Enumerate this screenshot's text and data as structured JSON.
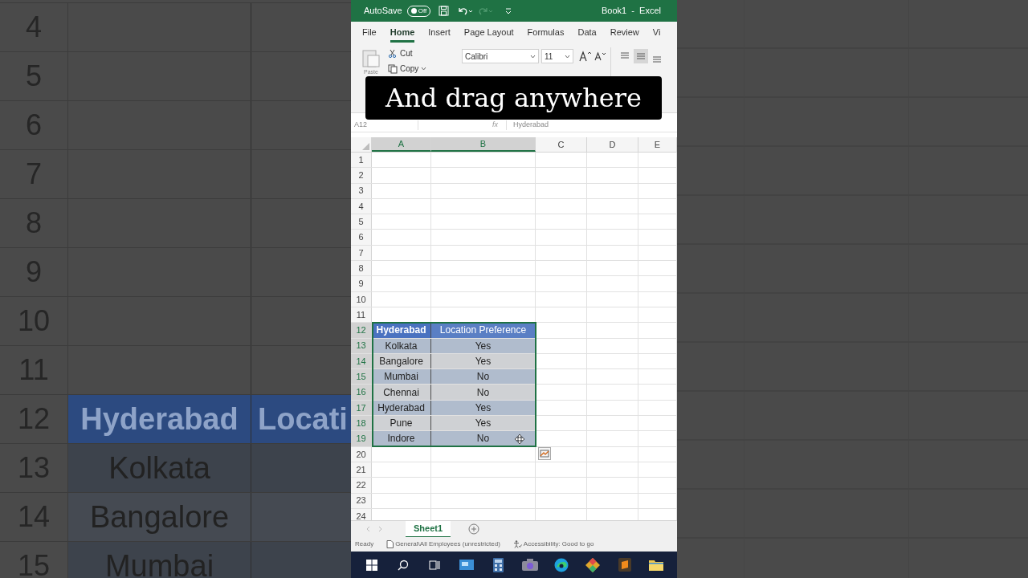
{
  "backdrop": {
    "rows": [
      {
        "number": "4"
      },
      {
        "number": "5"
      },
      {
        "number": "6"
      },
      {
        "number": "7"
      },
      {
        "number": "8"
      },
      {
        "number": "9"
      },
      {
        "number": "10"
      },
      {
        "number": "11"
      },
      {
        "number": "12",
        "kind": "header",
        "cells": [
          "Hyderabad",
          "Locati"
        ]
      },
      {
        "number": "13",
        "kind": "data",
        "cells": [
          "Kolkata"
        ]
      },
      {
        "number": "14",
        "kind": "data",
        "cells": [
          "Bangalore"
        ]
      },
      {
        "number": "15",
        "kind": "data",
        "cells": [
          "Mumbai"
        ]
      }
    ]
  },
  "title_bar": {
    "autosave_label": "AutoSave",
    "autosave_state": "Off",
    "autosave_on": false,
    "title": "Book1  -  Excel"
  },
  "tabs": [
    {
      "label": "File",
      "selected": false
    },
    {
      "label": "Home",
      "selected": true
    },
    {
      "label": "Insert",
      "selected": false
    },
    {
      "label": "Page Layout",
      "selected": false
    },
    {
      "label": "Formulas",
      "selected": false
    },
    {
      "label": "Data",
      "selected": false
    },
    {
      "label": "Review",
      "selected": false
    },
    {
      "label": "Vi",
      "selected": false
    }
  ],
  "ribbon": {
    "paste": "Paste",
    "cut": "Cut",
    "copy": "Copy",
    "font": "Calibri",
    "font_size": "11"
  },
  "caption": "And drag anywhere",
  "formula_bar": {
    "name_box": "A12",
    "fx": "fx",
    "content": "Hyderabad"
  },
  "sheet": {
    "columns": [
      {
        "label": "A",
        "selected": true
      },
      {
        "label": "B",
        "selected": true
      },
      {
        "label": "C",
        "selected": false
      },
      {
        "label": "D",
        "selected": false
      },
      {
        "label": "E",
        "selected": false
      }
    ],
    "rows": [
      {
        "number": "1",
        "selected": false
      },
      {
        "number": "2",
        "selected": false
      },
      {
        "number": "3",
        "selected": false
      },
      {
        "number": "4",
        "selected": false
      },
      {
        "number": "5",
        "selected": false
      },
      {
        "number": "6",
        "selected": false
      },
      {
        "number": "7",
        "selected": false
      },
      {
        "number": "8",
        "selected": false
      },
      {
        "number": "9",
        "selected": false
      },
      {
        "number": "10",
        "selected": false
      },
      {
        "number": "11",
        "selected": false
      },
      {
        "number": "12",
        "selected": true,
        "kind": "header",
        "cells": [
          "Hyderabad",
          "Location Preference"
        ]
      },
      {
        "number": "13",
        "selected": true,
        "kind": "data",
        "cells": [
          "Kolkata",
          "Yes"
        ]
      },
      {
        "number": "14",
        "selected": true,
        "kind": "data",
        "cells": [
          "Bangalore",
          "Yes"
        ]
      },
      {
        "number": "15",
        "selected": true,
        "kind": "data",
        "cells": [
          "Mumbai",
          "No"
        ]
      },
      {
        "number": "16",
        "selected": true,
        "kind": "data",
        "cells": [
          "Chennai",
          "No"
        ]
      },
      {
        "number": "17",
        "selected": true,
        "kind": "data",
        "cells": [
          "Hyderabad",
          "Yes"
        ]
      },
      {
        "number": "18",
        "selected": true,
        "kind": "data",
        "cells": [
          "Pune",
          "Yes"
        ]
      },
      {
        "number": "19",
        "selected": true,
        "kind": "data",
        "cells": [
          "Indore",
          "No"
        ]
      },
      {
        "number": "20",
        "selected": false
      },
      {
        "number": "21",
        "selected": false
      },
      {
        "number": "22",
        "selected": false
      },
      {
        "number": "23",
        "selected": false
      },
      {
        "number": "24",
        "selected": false
      }
    ]
  },
  "sheet_tabs": [
    {
      "label": "Sheet1",
      "selected": true
    }
  ],
  "status_bar": {
    "ready": "Ready",
    "label": "General\\All Employees (unrestricted)",
    "accessibility": "Accessibility: Good to go"
  }
}
